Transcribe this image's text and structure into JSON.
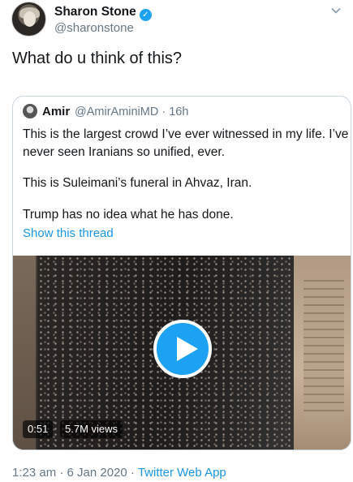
{
  "author": {
    "name": "Sharon Stone",
    "handle": "@sharonstone",
    "verified_mark": "✓"
  },
  "tweet_text": "What do u think of this?",
  "quoted": {
    "name": "Amir",
    "meta": "@AmirAminiMD · 16h",
    "lines": [
      "This is the largest crowd I’ve ever witnessed in my life. I’ve",
      "never seen Iranians so unified, ever.",
      "This is Suleimani’s funeral in Ahvaz, Iran.",
      "Trump has no idea what he has done."
    ],
    "show_thread": "Show this thread",
    "video": {
      "duration": "0:51",
      "views": "5.7M views"
    }
  },
  "footer": {
    "timestamp": "1:23 am · 6 Jan 2020 · ",
    "app": "Twitter Web App"
  },
  "colors": {
    "link": "#1b95e0",
    "verified": "#1da1f2",
    "secondary_text": "#657786",
    "border": "#ccd6dd"
  },
  "icons": [
    "verified-badge-icon",
    "chevron-down-icon",
    "play-icon"
  ]
}
